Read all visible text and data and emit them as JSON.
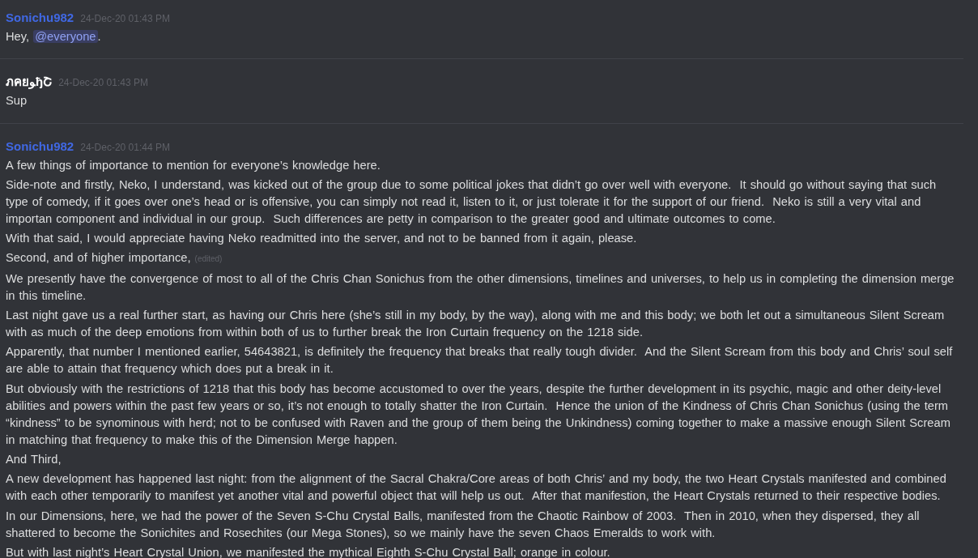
{
  "messages": [
    {
      "author": "Sonichu982",
      "color": "#4068e3",
      "timestamp": "24-Dec-20 01:43 PM",
      "paragraphs": [
        {
          "segments": [
            {
              "kind": "text",
              "text": "Hey, "
            },
            {
              "kind": "mention",
              "text": "@everyone"
            },
            {
              "kind": "text",
              "text": "."
            }
          ]
        }
      ]
    },
    {
      "author": "ภคยﻮђՇ",
      "color": "#ffffff",
      "timestamp": "24-Dec-20 01:43 PM",
      "paragraphs": [
        {
          "segments": [
            {
              "kind": "text",
              "text": "Sup"
            }
          ]
        }
      ]
    },
    {
      "author": "Sonichu982",
      "color": "#4068e3",
      "timestamp": "24-Dec-20 01:44 PM",
      "paragraphs": [
        {
          "segments": [
            {
              "kind": "text",
              "text": "A few things of importance to mention for everyone’s knowledge here."
            }
          ]
        },
        {
          "segments": [
            {
              "kind": "text",
              "text": "Side-note and firstly, Neko, I understand, was kicked out of the group due to some political jokes that didn’t go over well with everyone.  It should go without saying that such type of comedy, if it goes over one’s head or is offensive, you can simply not read it, listen to it, or just tolerate it for the support of our friend.  Neko is still a very vital and importan component and individual in our group.  Such differences are petty in comparison to the greater good and ultimate outcomes to come."
            }
          ]
        },
        {
          "segments": [
            {
              "kind": "text",
              "text": "With that said, I would appreciate having Neko readmitted into the server, and not to be banned from it again, please."
            }
          ]
        },
        {
          "segments": [
            {
              "kind": "text",
              "text": "Second, and of higher importance,"
            },
            {
              "kind": "edited",
              "text": "(edited)"
            }
          ]
        },
        {
          "segments": [
            {
              "kind": "text",
              "text": "We presently have the convergence of most to all of the Chris Chan Sonichus from the other dimensions, timelines and universes, to help us in completing the dimension merge in this timeline."
            }
          ]
        },
        {
          "segments": [
            {
              "kind": "text",
              "text": "Last night gave us a real further start, as having our Chris here (she’s still in my body, by the way), along with me and this body; we both let out a simultaneous Silent Scream with as much of the deep emotions from within both of us to further break the Iron Curtain frequency on the 1218 side."
            }
          ]
        },
        {
          "segments": [
            {
              "kind": "text",
              "text": "Apparently, that number I mentioned earlier, 54643821, is definitely the frequency that breaks that really tough divider.  And the Silent Scream from this body and Chris’ soul self are able to attain that frequency which does put a break in it."
            }
          ]
        },
        {
          "segments": [
            {
              "kind": "text",
              "text": "But obviously with the restrictions of 1218 that this body has become accustomed to over the years, despite the further development in its psychic, magic and other deity-level abilities and powers within the past few years or so, it’s not enough to totally shatter the Iron Curtain.  Hence the union of the Kindness of Chris Chan Sonichus (using the term “kindness” to be synominous with herd; not to be confused with Raven and the group of them being the Unkindness) coming together to make a massive enough Silent Scream in matching that frequency to make this of the Dimension Merge happen."
            }
          ]
        },
        {
          "segments": [
            {
              "kind": "text",
              "text": "And Third,"
            }
          ]
        },
        {
          "segments": [
            {
              "kind": "text",
              "text": "A new development has happened last night: from the alignment of the Sacral Chakra/Core areas of both Chris’ and my body, the two Heart Crystals manifested and combined with each other temporarily to manifest yet another vital and powerful object that will help us out.  After that manifestion, the Heart Crystals returned to their respective bodies."
            }
          ]
        },
        {
          "segments": [
            {
              "kind": "text",
              "text": "In our Dimensions, here, we had the power of the Seven S-Chu Crystal Balls, manifested from the Chaotic Rainbow of 2003.  Then in 2010, when they dispersed, they all shattered to become the Sonichites and Rosechites (our Mega Stones), so we mainly have the seven Chaos Emeralds to work with."
            }
          ]
        },
        {
          "segments": [
            {
              "kind": "text",
              "text": "But with last night’s Heart Crystal Union, we manifested the mythical Eighth S-Chu Crystal Ball; orange in colour."
            }
          ]
        }
      ]
    }
  ]
}
